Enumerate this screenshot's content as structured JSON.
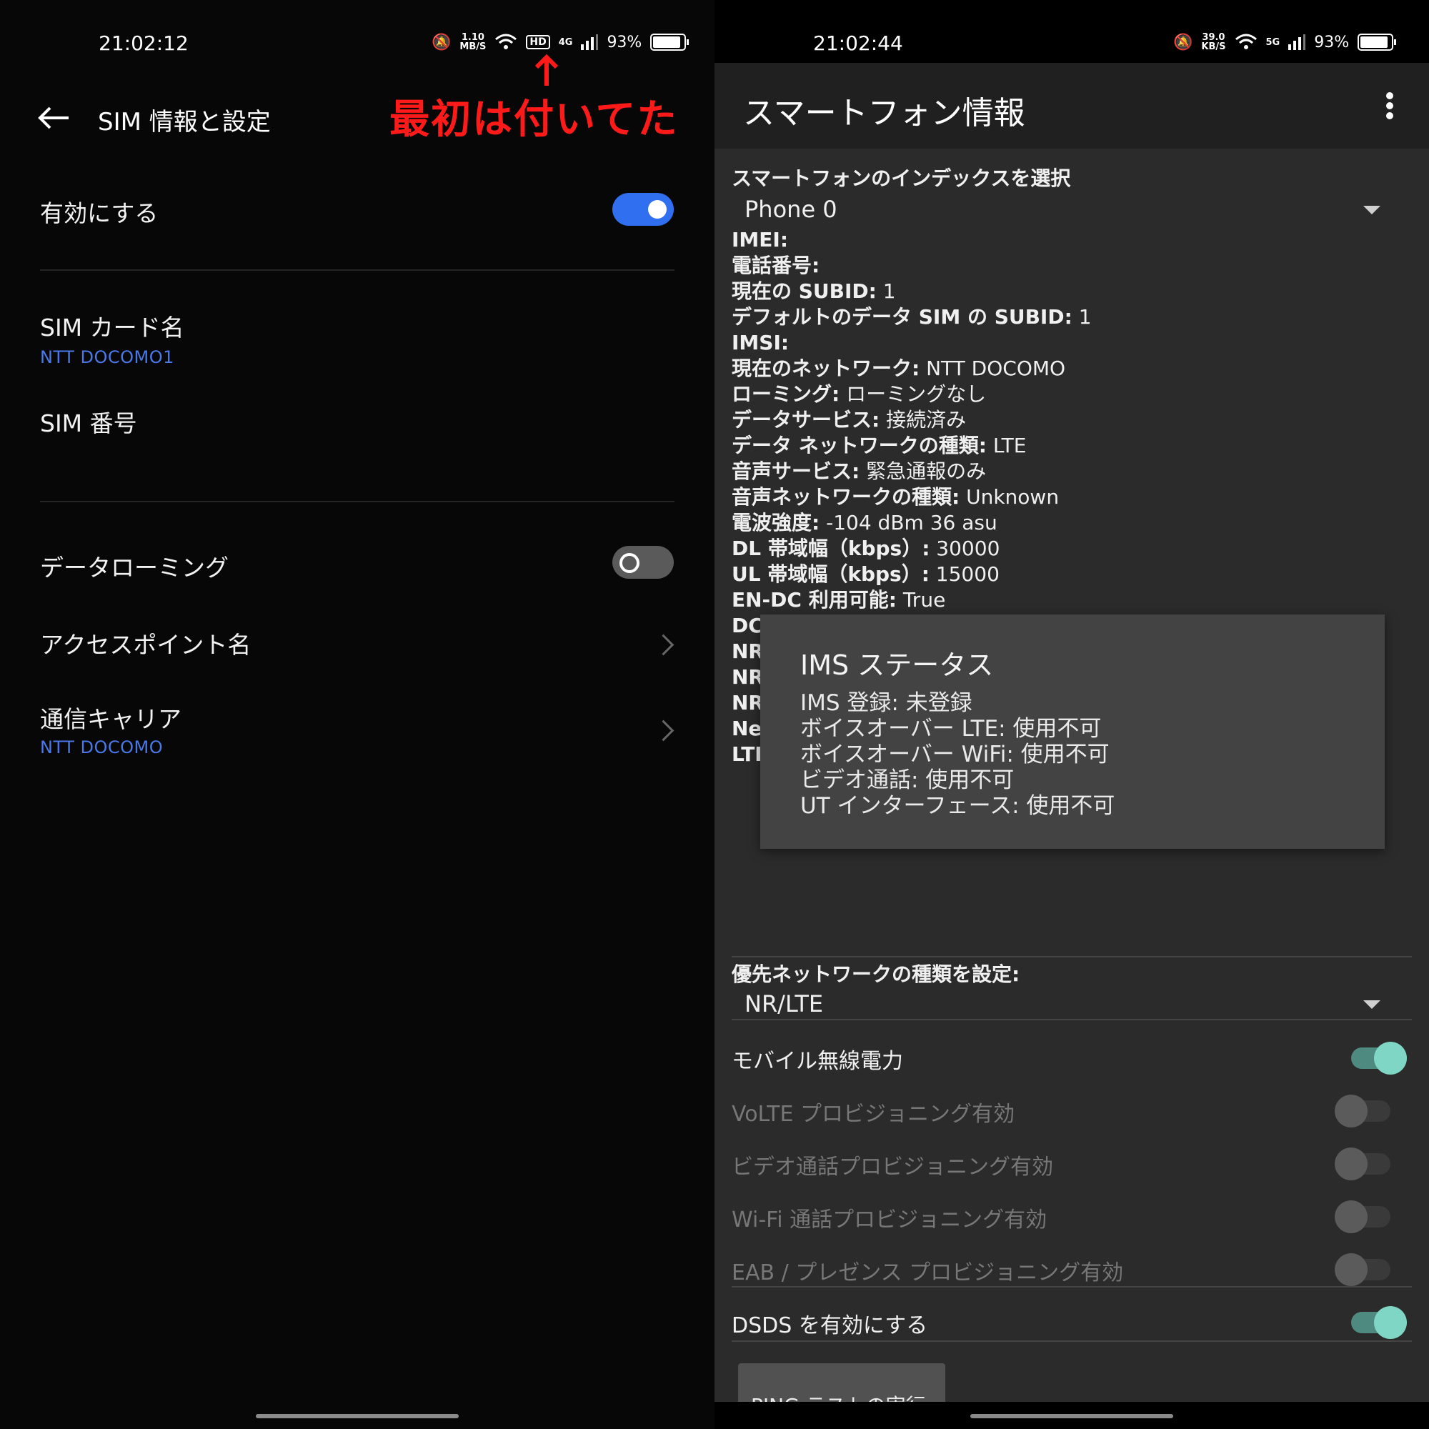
{
  "left": {
    "status": {
      "time": "21:02:12",
      "speed_top": "1.10",
      "speed_unit": "MB/S",
      "hd": "HD",
      "net": "4G",
      "battery": "93%"
    },
    "annotation": "最初は付いてた",
    "header": {
      "title": "SIM 情報と設定"
    },
    "enable": {
      "label": "有効にする",
      "state": "on"
    },
    "sim_card_name": {
      "label": "SIM カード名",
      "value": "NTT DOCOMO1"
    },
    "sim_number": {
      "label": "SIM 番号"
    },
    "data_roaming": {
      "label": "データローミング",
      "state": "off"
    },
    "apn": {
      "label": "アクセスポイント名"
    },
    "carrier": {
      "label": "通信キャリア",
      "value": "NTT DOCOMO"
    }
  },
  "right": {
    "status": {
      "time": "21:02:44",
      "speed_top": "39.0",
      "speed_unit": "KB/S",
      "net": "5G",
      "battery": "93%"
    },
    "header": {
      "title": "スマートフォン情報"
    },
    "phone_index": {
      "label": "スマートフォンのインデックスを選択",
      "value": "Phone 0"
    },
    "info": [
      {
        "key": "IMEI:",
        "val": ""
      },
      {
        "key": "電話番号:",
        "val": ""
      },
      {
        "key": "現在の SUBID:",
        "val": " 1"
      },
      {
        "key": "デフォルトのデータ SIM の SUBID:",
        "val": " 1"
      },
      {
        "key": "IMSI:",
        "val": ""
      },
      {
        "key": "現在のネットワーク:",
        "val": " NTT DOCOMO"
      },
      {
        "key": "ローミング:",
        "val": " ローミングなし"
      },
      {
        "key": "データサービス:",
        "val": " 接続済み"
      },
      {
        "key": "データ ネットワークの種類:",
        "val": " LTE"
      },
      {
        "key": "音声サービス:",
        "val": " 緊急通報のみ"
      },
      {
        "key": "音声ネットワークの種類:",
        "val": " Unknown"
      },
      {
        "key": "電波強度:",
        "val": " -104 dBm   36 asu"
      },
      {
        "key": "DL 帯域幅（kbps）:",
        "val": " 30000"
      },
      {
        "key": "UL 帯域幅（kbps）:",
        "val": " 15000"
      },
      {
        "key": "EN-DC 利用可能:",
        "val": " True"
      },
      {
        "key": "DC",
        "val": ""
      },
      {
        "key": "NR",
        "val": ""
      },
      {
        "key": "NR",
        "val": ""
      },
      {
        "key": "NR",
        "val": ""
      },
      {
        "key": "Net",
        "val": ""
      },
      {
        "key": "LTE",
        "val": ""
      }
    ],
    "ims_dialog": {
      "title": "IMS ステータス",
      "lines": [
        "IMS 登録: 未登録",
        "ボイスオーバー LTE: 使用不可",
        "ボイスオーバー WiFi: 使用不可",
        "ビデオ通話: 使用不可",
        "UT インターフェース: 使用不可"
      ]
    },
    "preferred_network": {
      "label": "優先ネットワークの種類を設定:",
      "value": "NR/LTE"
    },
    "toggles": [
      {
        "label": "モバイル無線電力",
        "state": "on",
        "enabled": true
      },
      {
        "label": "VoLTE プロビジョニング有効",
        "state": "off",
        "enabled": false
      },
      {
        "label": "ビデオ通話プロビジョニング有効",
        "state": "off",
        "enabled": false
      },
      {
        "label": "Wi-Fi 通話プロビジョニング有効",
        "state": "off",
        "enabled": false
      },
      {
        "label": "EAB / プレゼンス プロビジョニング有効",
        "state": "off",
        "enabled": false
      }
    ],
    "dsds": {
      "label": "DSDS を有効にする",
      "state": "on"
    },
    "ping_button": "PING テストの実行"
  },
  "colors": {
    "accent_blue": "#2f6ff0",
    "link_blue": "#4a78e8",
    "annotation_red": "#ff1a1a",
    "teal_on": "#7fd6c4"
  }
}
